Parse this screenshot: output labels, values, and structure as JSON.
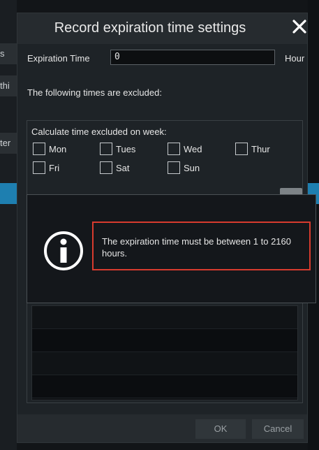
{
  "background": {
    "tabs": [
      "s",
      "thi",
      "ter"
    ]
  },
  "dialog": {
    "title": "Record expiration time settings",
    "expiration": {
      "label": "Expiration Time",
      "value": "0",
      "unit": "Hour"
    },
    "excluded_label": "The following times are excluded:",
    "week": {
      "title": "Calculate time excluded on week:",
      "days": [
        "Mon",
        "Tues",
        "Wed",
        "Thur",
        "Fri",
        "Sat",
        "Sun"
      ]
    },
    "buttons": {
      "ok": "OK",
      "cancel": "Cancel"
    }
  },
  "message": {
    "text": "The expiration time must be between 1 to 2160 hours."
  },
  "colors": {
    "highlight": "#d83b2e",
    "selection": "#1e7fb0"
  },
  "icons": {
    "close": "close-icon",
    "info": "info-icon"
  }
}
